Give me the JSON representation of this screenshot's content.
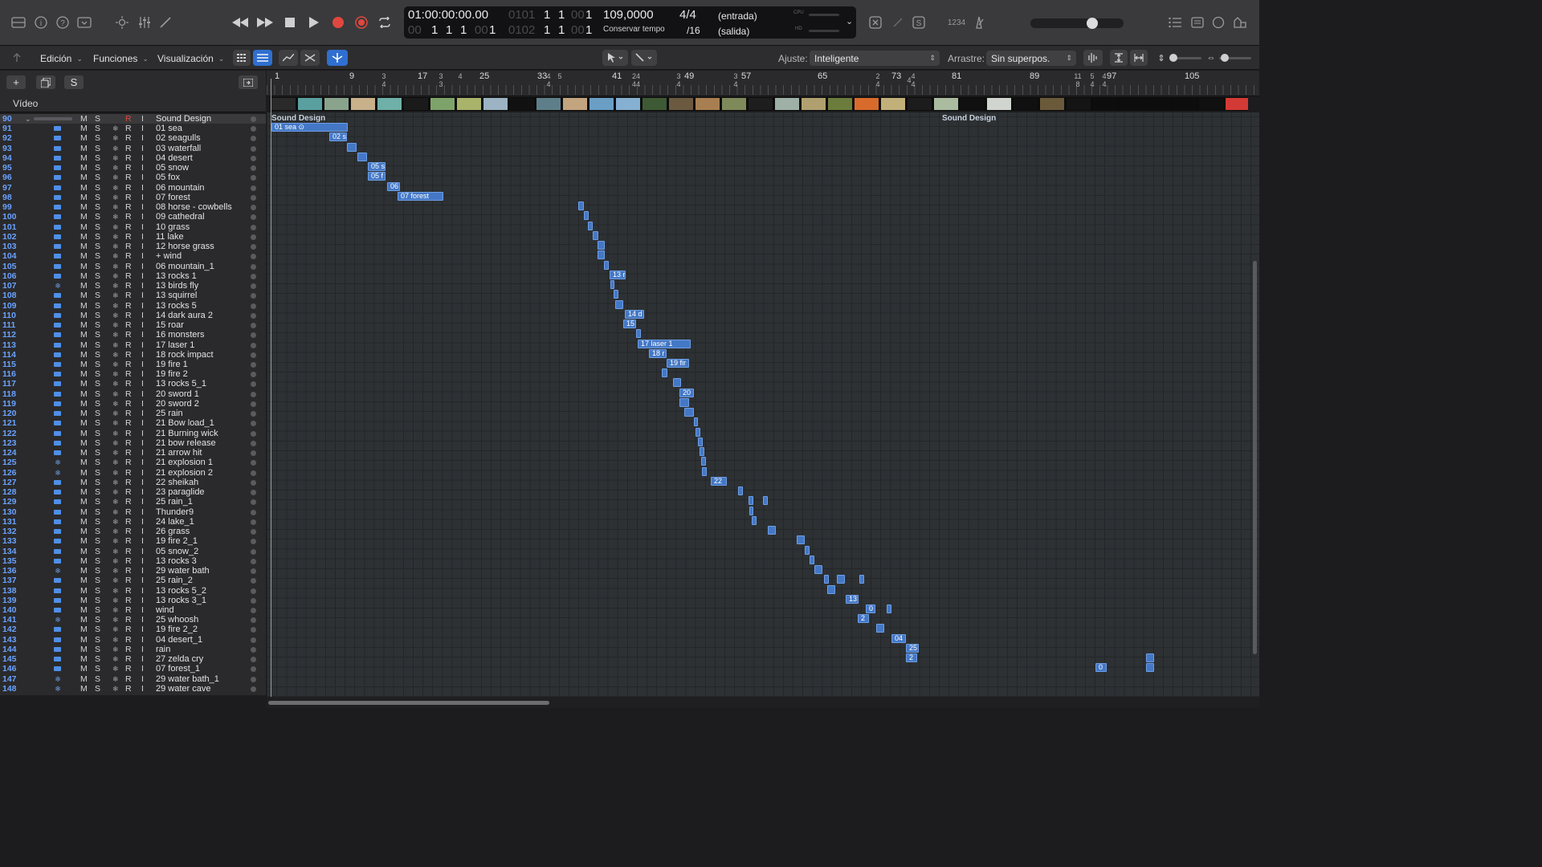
{
  "control_bar": {
    "timecode": "01:00:00:00.00",
    "pos_bar_dim": "0101",
    "pos_bar": "1",
    "pos_beat": "1",
    "pos_div_dim": "00",
    "pos_div": "1",
    "bars_dim": "00",
    "bars": "1",
    "beats": "1",
    "div": "1",
    "div_dim2": "00",
    "ticks": "1",
    "pos2_dim": "0102",
    "pos2_b": "1",
    "pos2_c": "1",
    "pos2_dim2": "00",
    "pos2_d": "1",
    "tempo": "109,0000",
    "tempo_mode": "Conservar tempo",
    "sig": "4/4",
    "div_sig": "/16",
    "in": "(entrada)",
    "out": "(salida)",
    "cpu": "CPU",
    "hd": "HD",
    "count_in": "1234"
  },
  "toolbar": {
    "edit": "Edición",
    "functions": "Funciones",
    "view": "Visualización",
    "snap_label": "Ajuste:",
    "snap_value": "Inteligente",
    "drag_label": "Arrastre:",
    "drag_value": "Sin superpos."
  },
  "tracks_header": {
    "video": "Vídeo",
    "s_btn": "S"
  },
  "tracks": [
    {
      "n": "90",
      "name": "Sound Design",
      "folder": true
    },
    {
      "n": "91",
      "name": "01 sea"
    },
    {
      "n": "92",
      "name": "02 seagulls"
    },
    {
      "n": "93",
      "name": "03 waterfall"
    },
    {
      "n": "94",
      "name": "04 desert"
    },
    {
      "n": "95",
      "name": "05 snow"
    },
    {
      "n": "96",
      "name": "05 fox"
    },
    {
      "n": "97",
      "name": "06 mountain"
    },
    {
      "n": "98",
      "name": "07 forest"
    },
    {
      "n": "99",
      "name": "08 horse - cowbells"
    },
    {
      "n": "100",
      "name": "09 cathedral"
    },
    {
      "n": "101",
      "name": "10 grass"
    },
    {
      "n": "102",
      "name": "11 lake"
    },
    {
      "n": "103",
      "name": "12 horse grass"
    },
    {
      "n": "104",
      "name": "+ wind"
    },
    {
      "n": "105",
      "name": "06 mountain_1"
    },
    {
      "n": "106",
      "name": "13 rocks 1"
    },
    {
      "n": "107",
      "name": "13 birds fly",
      "snow": true
    },
    {
      "n": "108",
      "name": "13 squirrel"
    },
    {
      "n": "109",
      "name": "13 rocks 5"
    },
    {
      "n": "110",
      "name": "14 dark aura 2"
    },
    {
      "n": "111",
      "name": "15 roar"
    },
    {
      "n": "112",
      "name": "16 monsters"
    },
    {
      "n": "113",
      "name": "17 laser 1"
    },
    {
      "n": "114",
      "name": "18 rock impact"
    },
    {
      "n": "115",
      "name": "19 fire 1"
    },
    {
      "n": "116",
      "name": "19 fire 2"
    },
    {
      "n": "117",
      "name": "13 rocks 5_1"
    },
    {
      "n": "118",
      "name": "20 sword 1"
    },
    {
      "n": "119",
      "name": "20 sword 2"
    },
    {
      "n": "120",
      "name": "25 rain"
    },
    {
      "n": "121",
      "name": "21 Bow load_1"
    },
    {
      "n": "122",
      "name": "21 Burning wick"
    },
    {
      "n": "123",
      "name": "21 bow release"
    },
    {
      "n": "124",
      "name": "21 arrow hit"
    },
    {
      "n": "125",
      "name": "21 explosion 1",
      "snow": true
    },
    {
      "n": "126",
      "name": "21 explosion 2",
      "snow": true
    },
    {
      "n": "127",
      "name": "22 sheikah"
    },
    {
      "n": "128",
      "name": "23 paraglide"
    },
    {
      "n": "129",
      "name": "25 rain_1"
    },
    {
      "n": "130",
      "name": "Thunder9"
    },
    {
      "n": "131",
      "name": "24 lake_1"
    },
    {
      "n": "132",
      "name": "26 grass"
    },
    {
      "n": "133",
      "name": "19 fire 2_1"
    },
    {
      "n": "134",
      "name": "05 snow_2"
    },
    {
      "n": "135",
      "name": "13 rocks 3"
    },
    {
      "n": "136",
      "name": "29 water bath",
      "snow": true
    },
    {
      "n": "137",
      "name": "25 rain_2"
    },
    {
      "n": "138",
      "name": "13 rocks 5_2"
    },
    {
      "n": "139",
      "name": "13 rocks 3_1"
    },
    {
      "n": "140",
      "name": "wind"
    },
    {
      "n": "141",
      "name": "25 whoosh",
      "snow": true
    },
    {
      "n": "142",
      "name": "19 fire 2_2"
    },
    {
      "n": "143",
      "name": "04 desert_1"
    },
    {
      "n": "144",
      "name": "rain"
    },
    {
      "n": "145",
      "name": "27 zelda cry"
    },
    {
      "n": "146",
      "name": "07 forest_1"
    },
    {
      "n": "147",
      "name": "29 water bath_1",
      "snow": true
    },
    {
      "n": "148",
      "name": "29 water cave",
      "snow": true
    }
  ],
  "track_buttons": {
    "m": "M",
    "s": "S",
    "r": "R",
    "i": "I"
  },
  "ruler": {
    "bars": [
      "1",
      "9",
      "17",
      "25",
      "33",
      "41",
      "49",
      "57",
      "65",
      "73",
      "81",
      "89",
      "97",
      "105"
    ],
    "extra_numbers": [
      "3",
      "4",
      "3",
      "3",
      "4",
      "4",
      "5",
      "4",
      "24",
      "44",
      "3",
      "4",
      "3",
      "4",
      "2",
      "4",
      "11",
      "8",
      "5",
      "4",
      "4",
      "4",
      "4",
      "4",
      "4"
    ]
  },
  "folder_label": "Sound Design",
  "regions": [
    {
      "t": 0,
      "label": "Sound Design",
      "folder": true
    },
    {
      "t": 1,
      "label": "01 sea ⊙"
    },
    {
      "t": 2,
      "label": "02 s"
    },
    {
      "t": 3,
      "label": ""
    },
    {
      "t": 4,
      "label": ""
    },
    {
      "t": 5,
      "label": "05 s"
    },
    {
      "t": 6,
      "label": "05 f"
    },
    {
      "t": 7,
      "label": "06"
    },
    {
      "t": 8,
      "label": "07 forest"
    },
    {
      "t": 16,
      "label": "13 r"
    },
    {
      "t": 20,
      "label": "14 d"
    },
    {
      "t": 21,
      "label": "15"
    },
    {
      "t": 23,
      "label": "17 laser 1"
    },
    {
      "t": 24,
      "label": "18 r"
    },
    {
      "t": 25,
      "label": "19 fir"
    },
    {
      "t": 28,
      "label": "20"
    },
    {
      "t": 37,
      "label": "22"
    },
    {
      "t": 49,
      "label": "13"
    },
    {
      "t": 50,
      "label": "0"
    },
    {
      "t": 51,
      "label": "2"
    },
    {
      "t": 53,
      "label": "04"
    },
    {
      "t": 54,
      "label": "25"
    },
    {
      "t": 55,
      "label": "2"
    },
    {
      "t": 56,
      "label": "0"
    }
  ]
}
